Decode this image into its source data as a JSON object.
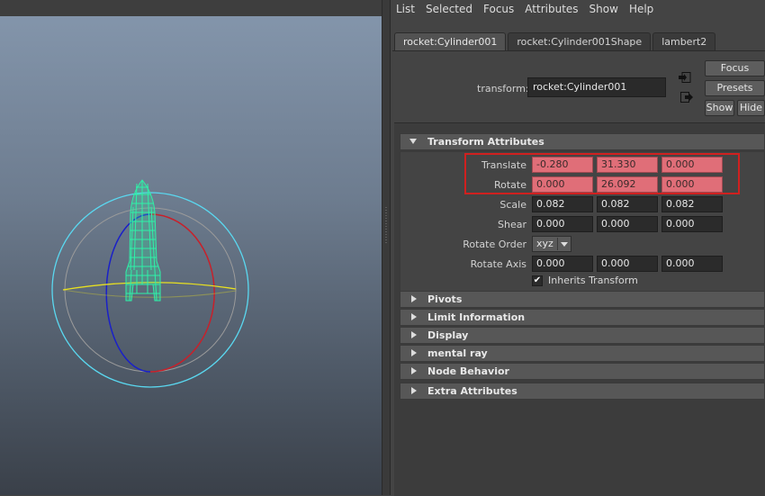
{
  "menu": [
    "List",
    "Selected",
    "Focus",
    "Attributes",
    "Show",
    "Help"
  ],
  "tabs": [
    "rocket:Cylinder001",
    "rocket:Cylinder001Shape",
    "lambert2"
  ],
  "transform": {
    "label": "transform:",
    "value": "rocket:Cylinder001"
  },
  "buttons": {
    "focus": "Focus",
    "presets": "Presets",
    "show": "Show",
    "hide": "Hide"
  },
  "sections": {
    "transform_attributes": "Transform Attributes",
    "collapsed": [
      "Pivots",
      "Limit Information",
      "Display",
      "mental ray",
      "Node Behavior",
      "Extra Attributes"
    ]
  },
  "attributes": {
    "translate": {
      "label": "Translate",
      "values": [
        "-0.280",
        "31.330",
        "0.000"
      ]
    },
    "rotate": {
      "label": "Rotate",
      "values": [
        "0.000",
        "26.092",
        "0.000"
      ]
    },
    "scale": {
      "label": "Scale",
      "values": [
        "0.082",
        "0.082",
        "0.082"
      ]
    },
    "shear": {
      "label": "Shear",
      "values": [
        "0.000",
        "0.000",
        "0.000"
      ]
    },
    "rotate_order": {
      "label": "Rotate Order",
      "value": "xyz"
    },
    "rotate_axis": {
      "label": "Rotate Axis",
      "values": [
        "0.000",
        "0.000",
        "0.000"
      ]
    },
    "inherits_transform": {
      "label": "Inherits Transform",
      "checked": true,
      "check_glyph": "✔"
    }
  },
  "colors": {
    "keyed_field": "#e06e78",
    "highlight": "#d0201f",
    "rocket_wire": "#2ef2a8",
    "manip_cyan": "#5ad8f0",
    "manip_red": "#c8202a",
    "manip_blue": "#1a20c8",
    "manip_yellow": "#e8e020"
  },
  "icons": [
    "rocket-model",
    "rotate-manipulator",
    "checkmark-icon",
    "dropdown-arrow-icon",
    "section-collapse-icon",
    "section-expand-icon"
  ]
}
